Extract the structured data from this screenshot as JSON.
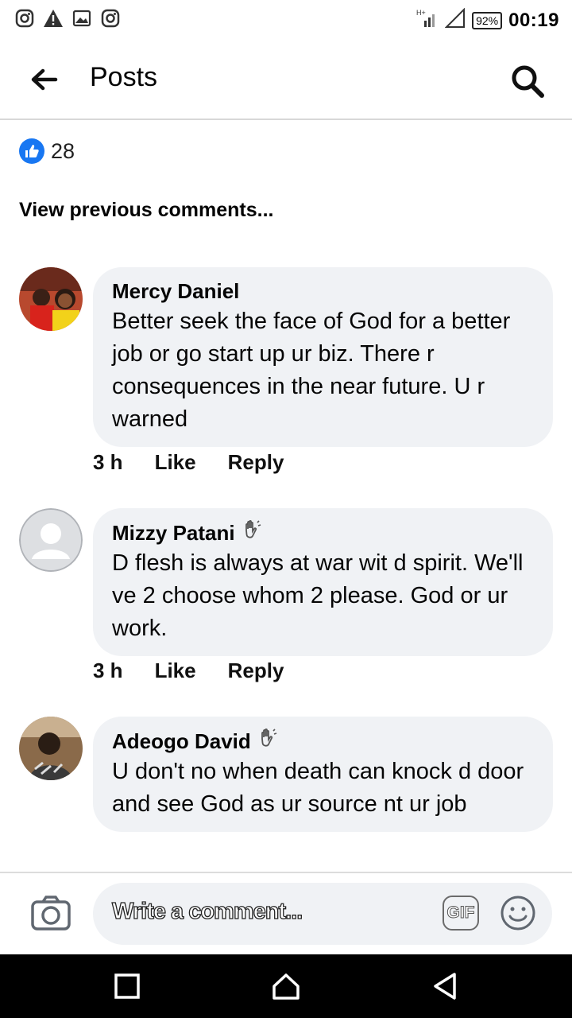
{
  "status_bar": {
    "battery": "92%",
    "time": "00:19",
    "icons": [
      "instagram-icon",
      "warning-icon",
      "image-icon",
      "instagram-icon",
      "signal-icon"
    ]
  },
  "header": {
    "title": "Posts",
    "back_icon": "arrow-left-icon",
    "search_icon": "search-icon"
  },
  "likes": {
    "count": "28",
    "icon": "thumbs-up-icon"
  },
  "view_previous": "View previous comments...",
  "comments": [
    {
      "author": "Mercy Daniel",
      "text": "Better seek the face of God for a better job or go start up ur biz. There r consequences in the near future. U r warned",
      "time": "3 h",
      "like": "Like",
      "reply": "Reply",
      "badge": false
    },
    {
      "author": "Mizzy Patani",
      "text": "D flesh is always at war wit d spirit. We'll ve 2 choose whom 2 please. God or ur work.",
      "time": "3 h",
      "like": "Like",
      "reply": "Reply",
      "badge": true
    },
    {
      "author": "Adeogo David",
      "text": "U don't no when death can knock d door and see God as ur source nt ur job",
      "badge": true
    }
  ],
  "composer": {
    "placeholder": "Write a comment...",
    "gif_label": "GIF",
    "camera_icon": "camera-icon",
    "emoji_icon": "smiley-icon"
  },
  "colors": {
    "accent": "#1877f2",
    "bubble": "#f0f2f5"
  }
}
